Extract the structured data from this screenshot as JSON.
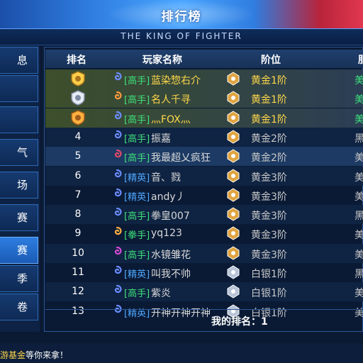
{
  "window": {
    "title": "排行榜",
    "subtitle": "THE KING OF FIGHTER"
  },
  "sidebar": {
    "items": [
      {
        "label": "息",
        "active": false
      },
      {
        "label": "",
        "active": false
      },
      {
        "label": "",
        "active": false
      },
      {
        "label": "气",
        "active": false
      },
      {
        "label": "场",
        "active": false
      },
      {
        "label": "赛",
        "active": false
      },
      {
        "label": "赛",
        "active": true
      },
      {
        "label": "季",
        "active": false
      },
      {
        "label": "卷",
        "active": false
      }
    ]
  },
  "table": {
    "headers": {
      "rank": "排名",
      "name": "玩家名称",
      "level": "阶位",
      "server": "服"
    },
    "rows": [
      {
        "rank": "",
        "medal": "gold",
        "tier": "[高手]",
        "name": "蓝染惣右介",
        "level": "黄金1阶",
        "level_color": "#ffd84a",
        "server": "美",
        "server_color": "#ffd84a"
      },
      {
        "rank": "",
        "medal": "silver",
        "tier": "[高手]",
        "name": "名人千寻",
        "level": "黄金1阶",
        "level_color": "#ffd84a",
        "server": "美",
        "server_color": "#ffd84a"
      },
      {
        "rank": "",
        "medal": "bronze",
        "tier": "[高手]",
        "name": "灬FOX灬",
        "level": "黄金1阶",
        "level_color": "#ffd84a",
        "server": "美",
        "server_color": "#ffd84a"
      },
      {
        "rank": "4",
        "medal": "",
        "tier": "[高手]",
        "name": "振嘉",
        "level": "黄金2阶",
        "level_color": "#c8c8c8",
        "server": "黑",
        "server_color": "#c8c8c8"
      },
      {
        "rank": "5",
        "medal": "",
        "tier": "[高手]",
        "name": "我最超乂疯狂",
        "level": "黄金2阶",
        "level_color": "#c8c8c8",
        "server": "美",
        "server_color": "#c8c8c8"
      },
      {
        "rank": "6",
        "medal": "",
        "tier": "[精英]",
        "name": "音、戮",
        "level": "黄金3阶",
        "level_color": "#c8c8c8",
        "server": "美",
        "server_color": "#c8c8c8"
      },
      {
        "rank": "7",
        "medal": "",
        "tier": "[精英]",
        "name": "andy丿",
        "level": "黄金3阶",
        "level_color": "#c8c8c8",
        "server": "美",
        "server_color": "#c8c8c8"
      },
      {
        "rank": "8",
        "medal": "",
        "tier": "[高手]",
        "name": "拳皇007",
        "level": "黄金3阶",
        "level_color": "#c8c8c8",
        "server": "黑",
        "server_color": "#c8c8c8"
      },
      {
        "rank": "9",
        "medal": "",
        "tier": "[拳手]",
        "name": "yq123",
        "level": "黄金3阶",
        "level_color": "#c8c8c8",
        "server": "美",
        "server_color": "#c8c8c8"
      },
      {
        "rank": "10",
        "medal": "",
        "tier": "[高手]",
        "name": "水镜雏花",
        "level": "黄金3阶",
        "level_color": "#c8c8c8",
        "server": "美",
        "server_color": "#c8c8c8"
      },
      {
        "rank": "11",
        "medal": "",
        "tier": "[精英]",
        "name": "叫我不帅",
        "level": "白银1阶",
        "level_color": "#c8c8c8",
        "server": "黑",
        "server_color": "#c8c8c8"
      },
      {
        "rank": "12",
        "medal": "",
        "tier": "[高手]",
        "name": "紫炎",
        "level": "白银1阶",
        "level_color": "#c8c8c8",
        "server": "美",
        "server_color": "#c8c8c8"
      },
      {
        "rank": "13",
        "medal": "",
        "tier": "[精英]",
        "name": "开神开神开神",
        "level": "白银1阶",
        "level_color": "#c8c8c8",
        "server": "美",
        "server_color": "#c8c8c8"
      }
    ]
  },
  "footer": {
    "my_rank_label": "我的排名：1"
  },
  "ticker": {
    "highlight": "游基金",
    "text": "等你来拿！"
  }
}
